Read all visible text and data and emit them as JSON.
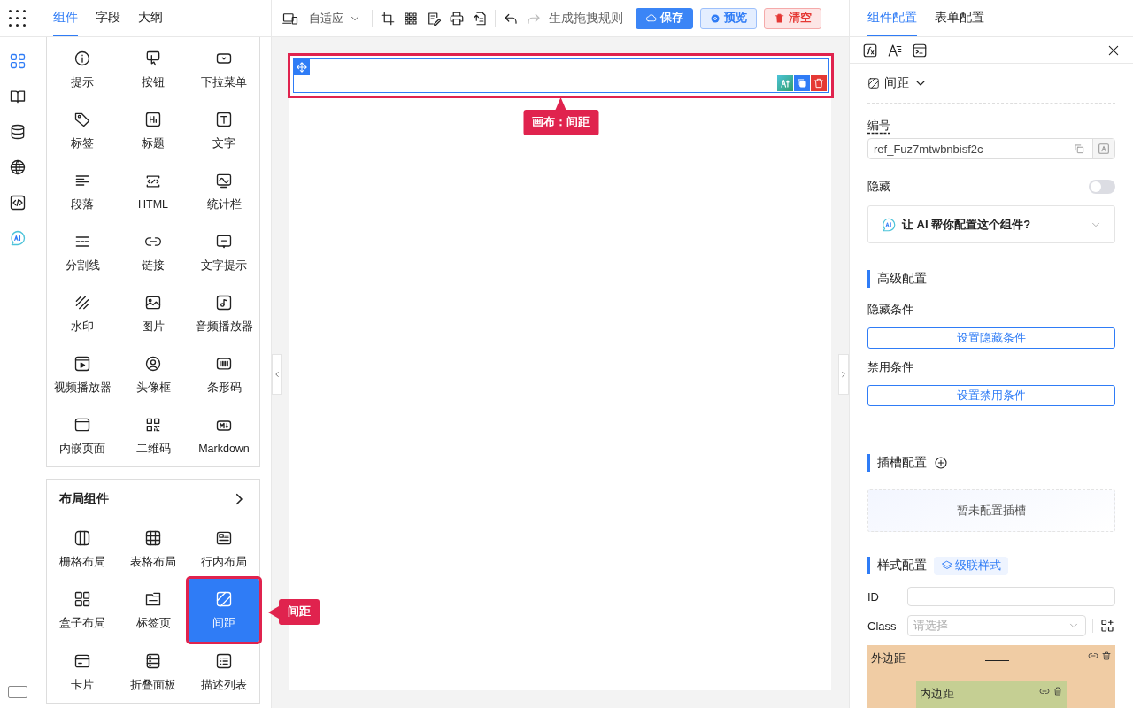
{
  "rail_items": [
    {
      "selected": true
    },
    {
      "selected": false
    },
    {
      "selected": false
    },
    {
      "selected": false
    },
    {
      "selected": false
    },
    {
      "selected": false
    }
  ],
  "left_tabs": [
    {
      "label": "组件",
      "selected": true
    },
    {
      "label": "字段",
      "selected": false
    },
    {
      "label": "大纲",
      "selected": false
    }
  ],
  "basic_components": [
    {
      "label": "提示"
    },
    {
      "label": "按钮"
    },
    {
      "label": "下拉菜单"
    },
    {
      "label": "标签"
    },
    {
      "label": "标题"
    },
    {
      "label": "文字"
    },
    {
      "label": "段落"
    },
    {
      "label": "HTML"
    },
    {
      "label": "统计栏"
    },
    {
      "label": "分割线"
    },
    {
      "label": "链接"
    },
    {
      "label": "文字提示"
    },
    {
      "label": "水印"
    },
    {
      "label": "图片"
    },
    {
      "label": "音频播放器"
    },
    {
      "label": "视频播放器"
    },
    {
      "label": "头像框"
    },
    {
      "label": "条形码"
    },
    {
      "label": "内嵌页面"
    },
    {
      "label": "二维码"
    },
    {
      "label": "Markdown"
    }
  ],
  "layout_group": {
    "title": "布局组件",
    "callout": "间距",
    "items": [
      {
        "label": "栅格布局",
        "selected": false
      },
      {
        "label": "表格布局",
        "selected": false
      },
      {
        "label": "行内布局",
        "selected": false
      },
      {
        "label": "盒子布局",
        "selected": false
      },
      {
        "label": "标签页",
        "selected": false
      },
      {
        "label": "间距",
        "selected": true
      },
      {
        "label": "卡片",
        "selected": false
      },
      {
        "label": "折叠面板",
        "selected": false
      },
      {
        "label": "描述列表",
        "selected": false
      }
    ]
  },
  "toolbar": {
    "mode": "自适应",
    "redo_disabled": true,
    "rule_button": "生成拖拽规则",
    "buttons": [
      {
        "label": "保存",
        "kind": "primary"
      },
      {
        "label": "预览",
        "kind": "preview"
      },
      {
        "label": "清空",
        "kind": "danger"
      }
    ]
  },
  "canvas": {
    "block": {
      "selected": true,
      "callout": "画布：间距"
    }
  },
  "right_tabs": [
    {
      "label": "组件配置",
      "selected": true
    },
    {
      "label": "表单配置",
      "selected": false
    }
  ],
  "component_name": "间距",
  "ref_field": {
    "label": "编号",
    "value": "ref_Fuz7mtwbnbisf2c"
  },
  "hidden": {
    "label": "隐藏",
    "on": false
  },
  "ai_helper": {
    "text": "让 AI 帮你配置这个组件?",
    "expanded": false
  },
  "advanced": {
    "title": "高级配置",
    "rows": [
      {
        "label": "隐藏条件",
        "button": "设置隐藏条件"
      },
      {
        "label": "禁用条件",
        "button": "设置禁用条件"
      }
    ]
  },
  "slots": {
    "title": "插槽配置",
    "empty": "暂未配置插槽"
  },
  "style": {
    "title": "样式配置",
    "cascade": "级联样式",
    "id_label": "ID",
    "class_label": "Class",
    "class_placeholder": "请选择",
    "margin_label": "外边距",
    "padding_label": "内边距"
  }
}
